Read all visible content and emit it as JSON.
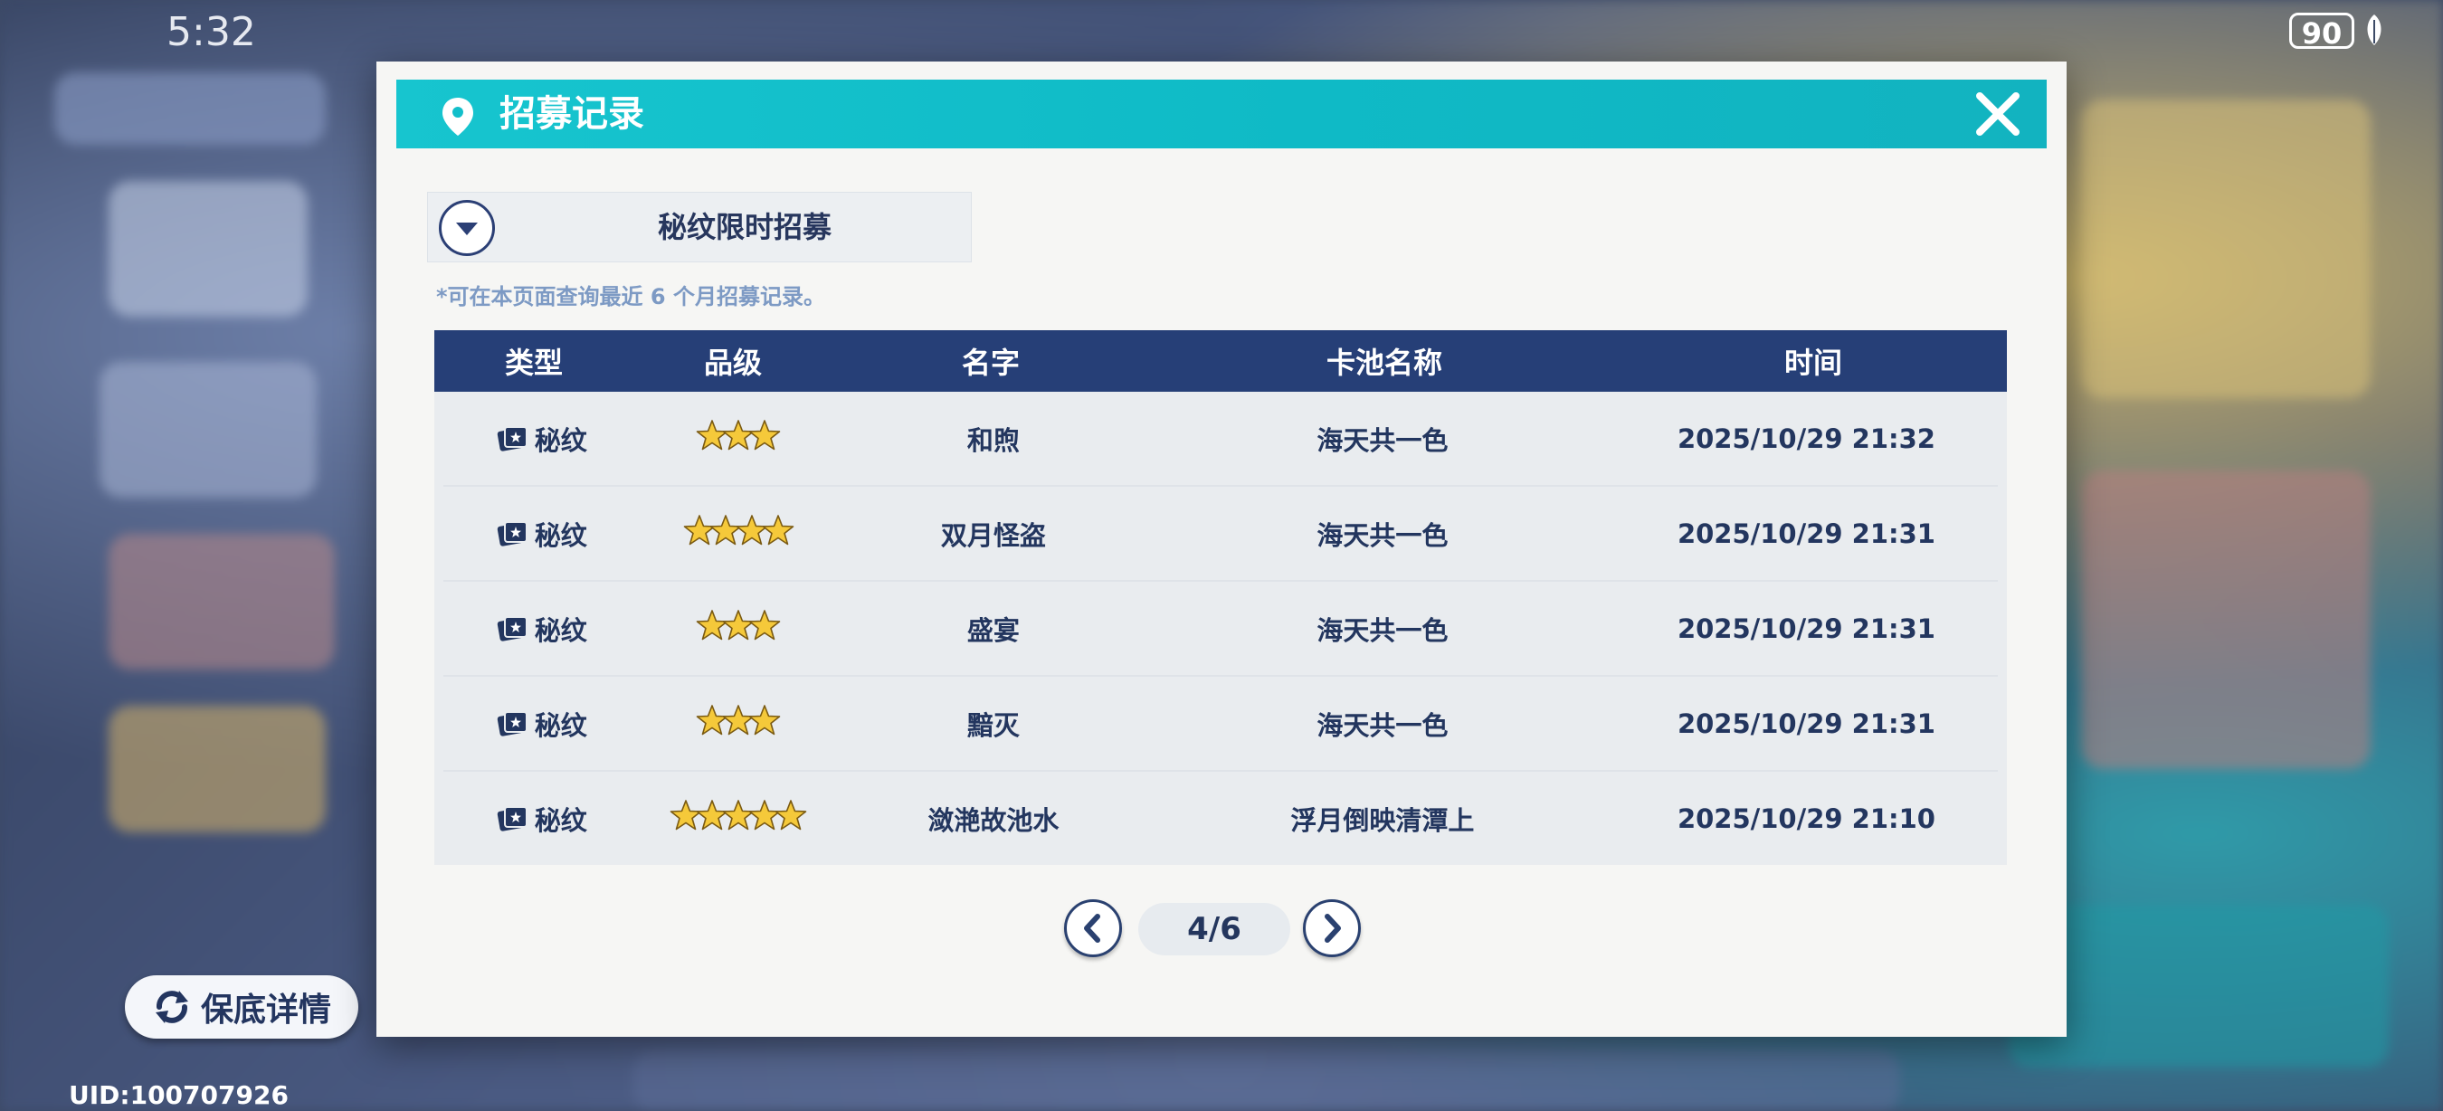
{
  "status_bar": {
    "time": "5:32",
    "battery": "90"
  },
  "dialog": {
    "title": "招募记录",
    "pool_select": {
      "selected": "秘纹限时招募"
    },
    "note": "*可在本页面查询最近 6 个月招募记录。",
    "table": {
      "headers": [
        "类型",
        "品级",
        "名字",
        "卡池名称",
        "时间"
      ],
      "rows": [
        {
          "type": "秘纹",
          "stars": 3,
          "name": "和煦",
          "pool": "海天共一色",
          "time": "2025/10/29 21:32"
        },
        {
          "type": "秘纹",
          "stars": 4,
          "name": "双月怪盗",
          "pool": "海天共一色",
          "time": "2025/10/29 21:31"
        },
        {
          "type": "秘纹",
          "stars": 3,
          "name": "盛宴",
          "pool": "海天共一色",
          "time": "2025/10/29 21:31"
        },
        {
          "type": "秘纹",
          "stars": 3,
          "name": "黯灭",
          "pool": "海天共一色",
          "time": "2025/10/29 21:31"
        },
        {
          "type": "秘纹",
          "stars": 5,
          "name": "潋滟故池水",
          "pool": "浮月倒映清潭上",
          "time": "2025/10/29 21:10"
        }
      ]
    },
    "pager": {
      "page": "4/6"
    }
  },
  "guarantee_button": {
    "label": "保底详情"
  },
  "uid": "UID:100707926",
  "colors": {
    "title_bar": "#12bfca",
    "table_header": "#263f77",
    "text_dark": "#23365f",
    "star_gold": "#f5c93a"
  },
  "icons": {
    "title": "location-pin-icon",
    "close": "close-icon",
    "dropdown": "chevron-down-icon",
    "type": "card-icon",
    "grade": "star-icon",
    "prev": "chevron-left-icon",
    "next": "chevron-right-icon",
    "guarantee": "cycle-arrows-icon"
  }
}
